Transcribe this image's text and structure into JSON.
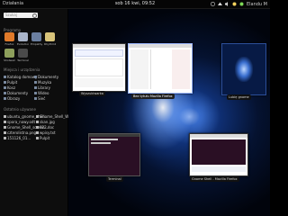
{
  "topbar": {
    "activities": "Działania",
    "clock": "sob 16 kwi, 09:52",
    "user": "Elandu M"
  },
  "left": {
    "search_placeholder": "Szukaj",
    "applications_title": "Programy",
    "apps": [
      {
        "label": "Firefox",
        "icon": "firefox-icon",
        "color": "#e07a2a"
      },
      {
        "label": "Evolution",
        "icon": "evolution-icon",
        "color": "#a9b4c9"
      },
      {
        "label": "Empathy",
        "icon": "empathy-icon",
        "color": "#6b7fa0"
      },
      {
        "label": "Rhythmbox",
        "icon": "rhythmbox-icon",
        "color": "#d8c37a"
      },
      {
        "label": "Shotwell",
        "icon": "shotwell-icon",
        "color": "#8ea05c"
      },
      {
        "label": "Terminal",
        "icon": "terminal-icon",
        "color": "#4a4a4a"
      }
    ],
    "places_title": "Miejsca i urządzenia",
    "places_left": [
      "Katalog domowy",
      "Pulpit",
      "Kosz",
      "Dokumenty",
      "Obrazy"
    ],
    "places_right": [
      "Dokumenty",
      "Muzyka",
      "Library",
      "Wideo",
      "Sieć"
    ],
    "recent_title": "Ostatnio używane",
    "recent_left": [
      "ubuntu_gnome_shell...",
      "spora_nowy.odt",
      "Gnome_Shell_screen...",
      "czterolistna.png",
      "151126_01..."
    ],
    "recent_right": [
      "Gnome_Shell_Wyglad...",
      "skan.jpg",
      "022.doc",
      "wpisy.txt",
      "Pulpit"
    ]
  },
  "windows": [
    {
      "caption": "Wyszukiwarka",
      "highlight": false
    },
    {
      "caption": "Bez tytułu Mozilla Firefox",
      "highlight": true
    },
    {
      "caption": "Lubię gnome",
      "highlight": false
    },
    {
      "caption": "Terminal",
      "highlight": false
    },
    {
      "caption": "Gnome Shell - Mozilla Firefox",
      "highlight": false
    }
  ]
}
